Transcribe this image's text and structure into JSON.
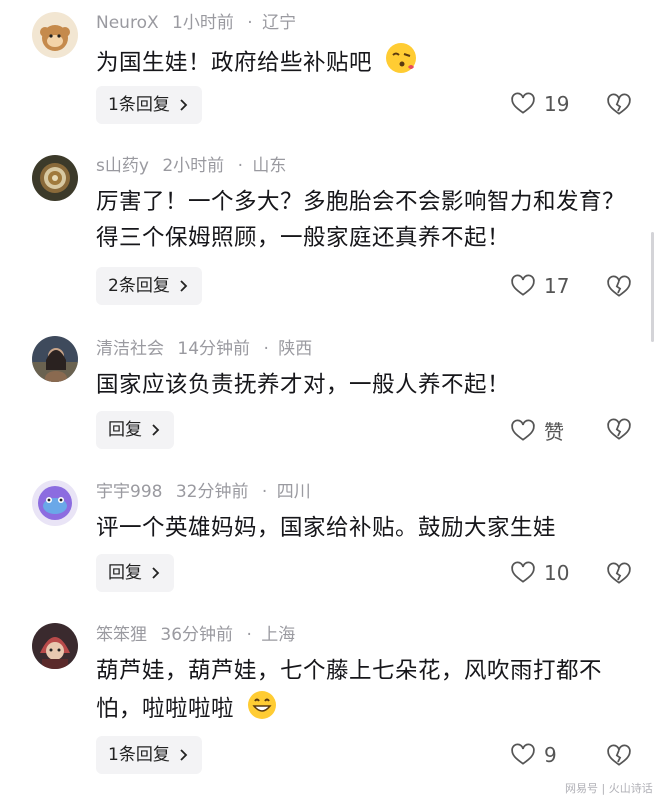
{
  "comments": [
    {
      "user": "NeuroX",
      "time": "1小时前",
      "location": "辽宁",
      "text": "为国生娃！政府给些补贴吧",
      "emoji": "kissing-face-emoji",
      "replies": "1条回复",
      "likes": "19"
    },
    {
      "user": "s山药y",
      "time": "2小时前",
      "location": "山东",
      "text": "厉害了！一个多大？多胞胎会不会影响智力和发育？得三个保姆照顾，一般家庭还真养不起！",
      "replies": "2条回复",
      "likes": "17"
    },
    {
      "user": "清洁社会",
      "time": "14分钟前",
      "location": "陕西",
      "text": "国家应该负责抚养才对，一般人养不起！",
      "replies": "回复",
      "likes": "赞"
    },
    {
      "user": "宇宇998",
      "time": "32分钟前",
      "location": "四川",
      "text": "评一个英雄妈妈，国家给补贴。鼓励大家生娃",
      "replies": "回复",
      "likes": "10"
    },
    {
      "user": "笨笨狸",
      "time": "36分钟前",
      "location": "上海",
      "text": "葫芦娃，葫芦娃，七个藤上七朵花，风吹雨打都不怕，啦啦啦啦",
      "emoji": "grinning-face-emoji",
      "replies": "1条回复",
      "likes": "9"
    }
  ],
  "watermark": "网易号 | 火山诗话",
  "colors": {
    "meta": "#9a9aa0",
    "text": "#16161a",
    "button_bg": "#f3f3f5"
  }
}
